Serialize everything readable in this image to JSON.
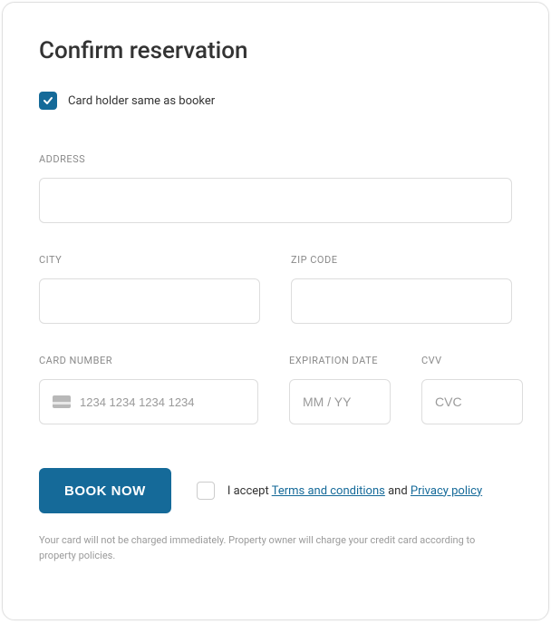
{
  "title": "Confirm reservation",
  "same_as_booker": {
    "label": "Card holder same as booker",
    "checked": true
  },
  "fields": {
    "address": {
      "label": "ADDRESS",
      "value": ""
    },
    "city": {
      "label": "CITY",
      "value": ""
    },
    "zip": {
      "label": "ZIP CODE",
      "value": ""
    },
    "card_number": {
      "label": "CARD NUMBER",
      "placeholder": "1234 1234 1234 1234",
      "value": ""
    },
    "expiration": {
      "label": "EXPIRATION DATE",
      "placeholder": "MM / YY",
      "value": ""
    },
    "cvv": {
      "label": "CVV",
      "placeholder": "CVC",
      "value": ""
    }
  },
  "book_button": "BOOK NOW",
  "accept": {
    "checked": false,
    "prefix": "I accept ",
    "terms_text": "Terms and conditions",
    "and": " and ",
    "privacy_text": "Privacy policy"
  },
  "disclaimer": "Your card will not be charged immediately. Property owner will charge your credit card according to property policies.",
  "colors": {
    "accent": "#156a99"
  }
}
